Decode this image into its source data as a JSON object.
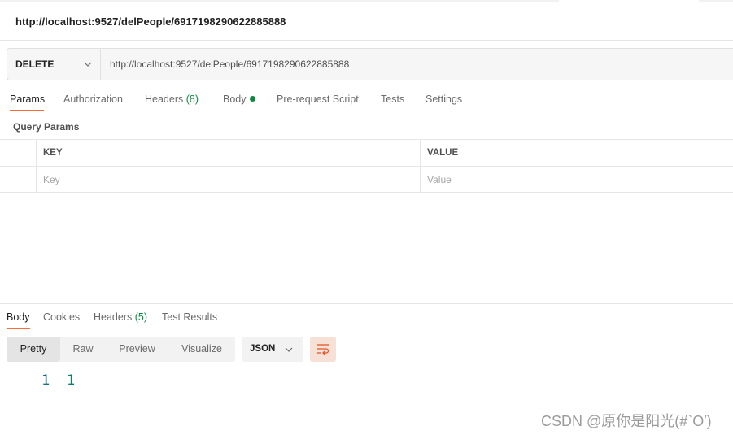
{
  "header": {
    "title": "http://localhost:9527/delPeople/6917198290622885888"
  },
  "request": {
    "method": "DELETE",
    "url": "http://localhost:9527/delPeople/6917198290622885888"
  },
  "request_tabs": {
    "params": "Params",
    "authorization": "Authorization",
    "headers": "Headers",
    "headers_count": "(8)",
    "body": "Body",
    "prerequest": "Pre-request Script",
    "tests": "Tests",
    "settings": "Settings",
    "active": "Params"
  },
  "query_params": {
    "title": "Query Params",
    "col_key": "KEY",
    "col_value": "VALUE",
    "key_placeholder": "Key",
    "value_placeholder": "Value"
  },
  "response_tabs": {
    "body": "Body",
    "cookies": "Cookies",
    "headers": "Headers",
    "headers_count": "(5)",
    "test_results": "Test Results",
    "active": "Body"
  },
  "response_view": {
    "modes": [
      "Pretty",
      "Raw",
      "Preview",
      "Visualize"
    ],
    "active_mode": "Pretty",
    "format": "JSON"
  },
  "response_body": {
    "lines": [
      {
        "number": "1",
        "text": "1"
      }
    ]
  },
  "watermark": "CSDN @原你是阳光(#`O′)",
  "colors": {
    "accent": "#ff6c37",
    "count_green": "#0b8a3f",
    "line_number": "#1c6e8c",
    "code_value": "#0f7b6c"
  }
}
